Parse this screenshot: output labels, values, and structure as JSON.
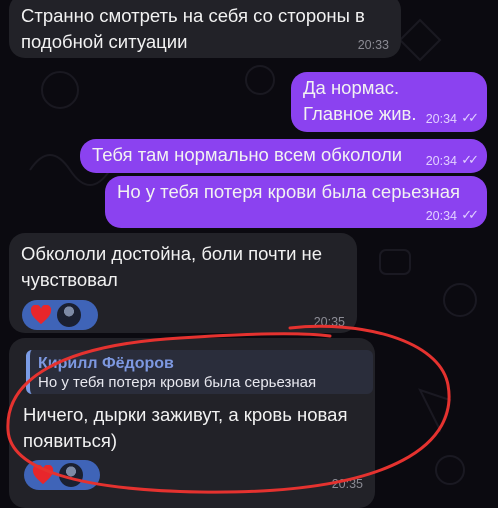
{
  "messages": [
    {
      "text": "Странно смотреть на себя со стороны в подобной ситуации",
      "time": "20:33"
    },
    {
      "text": "Да нормас.\nГлавное жив.",
      "time": "20:34"
    },
    {
      "text": "Тебя там нормально всем обкололи",
      "time": "20:34"
    },
    {
      "text": "Но у тебя потеря крови была серьезная",
      "time": "20:34"
    },
    {
      "text": "Обкололи достойна, боли почти не чувствовал",
      "time": "20:35"
    },
    {
      "reply_author": "Кирилл Фёдоров",
      "reply_text": "Но у тебя потеря крови была серьезная",
      "text": "Ничего, дырки заживут, а кровь новая появиться)",
      "time": "20:35"
    }
  ],
  "reactions": {
    "emoji": "heart-icon",
    "count_avatars": 1
  },
  "colors": {
    "outgoing": "#8b42f0",
    "incoming": "#222228",
    "annotation": "#e5322f"
  }
}
